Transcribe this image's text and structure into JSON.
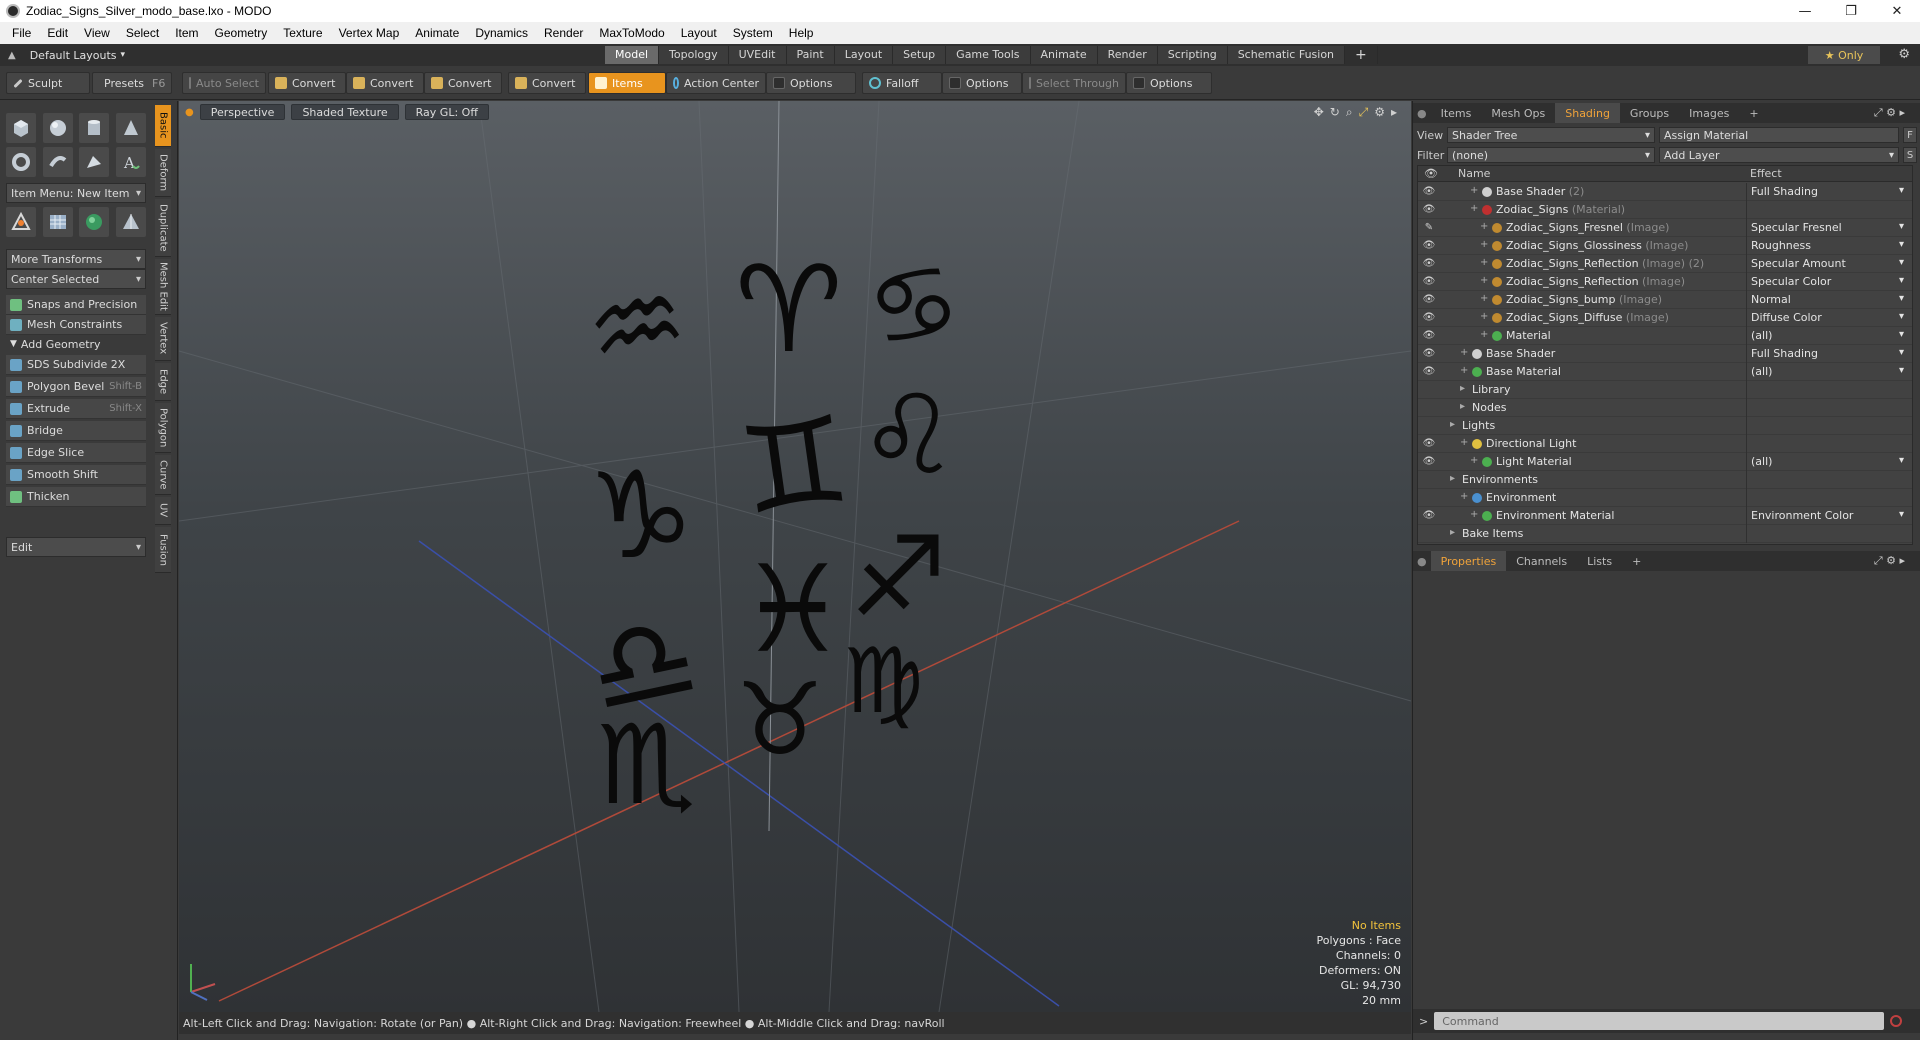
{
  "window": {
    "title": "Zodiac_Signs_Silver_modo_base.lxo - MODO",
    "controls": [
      "—",
      "❐",
      "✕"
    ]
  },
  "menu": [
    "File",
    "Edit",
    "View",
    "Select",
    "Item",
    "Geometry",
    "Texture",
    "Vertex Map",
    "Animate",
    "Dynamics",
    "Render",
    "MaxToModo",
    "Layout",
    "System",
    "Help"
  ],
  "layoutbar": {
    "layout_label": "Default Layouts",
    "tabs": [
      "Model",
      "Topology",
      "UVEdit",
      "Paint",
      "Layout",
      "Setup",
      "Game Tools",
      "Animate",
      "Render",
      "Scripting",
      "Schematic Fusion"
    ],
    "active_tab": "Model",
    "plus": "+",
    "only_label": "★  Only"
  },
  "toolbar": {
    "sculpt": "Sculpt",
    "presets": "Presets",
    "presets_key": "F6",
    "auto_select": "Auto Select",
    "convert": "Convert",
    "items": "Items",
    "action_center": "Action Center",
    "options": "Options",
    "falloff": "Falloff",
    "select_through": "Select Through"
  },
  "leftpanel": {
    "item_menu": "Item Menu: New Item",
    "more_transforms": "More Transforms",
    "center_selected": "Center Selected",
    "snaps": "Snaps and Precision",
    "mesh_constraints": "Mesh Constraints",
    "add_geometry": "Add Geometry",
    "tools": [
      {
        "label": "SDS Subdivide 2X",
        "key": ""
      },
      {
        "label": "Polygon Bevel",
        "key": "Shift-B"
      },
      {
        "label": "Extrude",
        "key": "Shift-X"
      },
      {
        "label": "Bridge",
        "key": ""
      },
      {
        "label": "Edge Slice",
        "key": ""
      },
      {
        "label": "Smooth Shift",
        "key": ""
      },
      {
        "label": "Thicken",
        "key": ""
      }
    ],
    "edit_dropdown": "Edit",
    "vtabs": [
      "Basic",
      "Deform",
      "Duplicate",
      "Mesh Edit",
      "Vertex",
      "Edge",
      "Polygon",
      "Curve",
      "UV",
      "Fusion"
    ]
  },
  "viewport": {
    "view_mode": "Perspective",
    "shading": "Shaded Texture",
    "raygl": "Ray GL: Off",
    "info": {
      "selection": "No Items",
      "polygons": "Polygons : Face",
      "channels": "Channels: 0",
      "deformers": "Deformers: ON",
      "gl": "GL: 94,730",
      "scale": "20 mm"
    },
    "glyphs": [
      "♒",
      "♈",
      "♋",
      "♑",
      "♊",
      "♌",
      "♓",
      "♐",
      "♎",
      "♉",
      "♏",
      "♍"
    ]
  },
  "statusbar": "Alt-Left Click and Drag: Navigation: Rotate (or Pan) ● Alt-Right Click and Drag: Navigation: Freewheel ● Alt-Middle Click and Drag: navRoll",
  "rightpanel": {
    "tabs": [
      "Items",
      "Mesh Ops",
      "Shading",
      "Groups",
      "Images"
    ],
    "active_tab": "Shading",
    "view_label": "View",
    "view_value": "Shader Tree",
    "assign_material": "Assign Material",
    "filter_label": "Filter",
    "filter_value": "(none)",
    "add_layer": "Add Layer",
    "col_name": "Name",
    "col_effect": "Effect",
    "tree": [
      {
        "name": "Base Shader",
        "sub": " (2)",
        "effect": "Full Shading",
        "color": "#d0d0d0",
        "indent": 3,
        "eye": true
      },
      {
        "name": "Zodiac_Signs",
        "sub": " (Material)",
        "effect": "",
        "color": "#c03030",
        "indent": 3,
        "eye": true
      },
      {
        "name": "Zodiac_Signs_Fresnel",
        "sub": " (Image)",
        "effect": "Specular Fresnel",
        "color": "#c08a30",
        "indent": 4,
        "eye": "brush"
      },
      {
        "name": "Zodiac_Signs_Glossiness",
        "sub": " (Image)",
        "effect": "Roughness",
        "color": "#c08a30",
        "indent": 4,
        "eye": true
      },
      {
        "name": "Zodiac_Signs_Reflection",
        "sub": " (Image) (2)",
        "effect": "Specular Amount",
        "color": "#c08a30",
        "indent": 4,
        "eye": true
      },
      {
        "name": "Zodiac_Signs_Reflection",
        "sub": " (Image)",
        "effect": "Specular Color",
        "color": "#c08a30",
        "indent": 4,
        "eye": true
      },
      {
        "name": "Zodiac_Signs_bump",
        "sub": " (Image)",
        "effect": "Normal",
        "color": "#c08a30",
        "indent": 4,
        "eye": true
      },
      {
        "name": "Zodiac_Signs_Diffuse",
        "sub": " (Image)",
        "effect": "Diffuse Color",
        "color": "#c08a30",
        "indent": 4,
        "eye": true
      },
      {
        "name": "Material",
        "sub": "",
        "effect": "(all)",
        "color": "#4caf50",
        "indent": 4,
        "eye": true
      },
      {
        "name": "Base Shader",
        "sub": "",
        "effect": "Full Shading",
        "color": "#d0d0d0",
        "indent": 2,
        "eye": true
      },
      {
        "name": "Base Material",
        "sub": "",
        "effect": "(all)",
        "color": "#4caf50",
        "indent": 2,
        "eye": true
      },
      {
        "name": "Library",
        "sub": "",
        "effect": "",
        "color": "",
        "indent": 2,
        "eye": false
      },
      {
        "name": "Nodes",
        "sub": "",
        "effect": "",
        "color": "",
        "indent": 2,
        "eye": false
      },
      {
        "name": "Lights",
        "sub": "",
        "effect": "",
        "color": "",
        "indent": 1,
        "eye": false
      },
      {
        "name": "Directional Light",
        "sub": "",
        "effect": "",
        "color": "#e0c040",
        "indent": 2,
        "eye": true
      },
      {
        "name": "Light Material",
        "sub": "",
        "effect": "(all)",
        "color": "#4caf50",
        "indent": 3,
        "eye": true
      },
      {
        "name": "Environments",
        "sub": "",
        "effect": "",
        "color": "",
        "indent": 1,
        "eye": false
      },
      {
        "name": "Environment",
        "sub": "",
        "effect": "",
        "color": "#4a90d0",
        "indent": 2,
        "eye": false
      },
      {
        "name": "Environment Material",
        "sub": "",
        "effect": "Environment Color",
        "color": "#4caf50",
        "indent": 3,
        "eye": true
      },
      {
        "name": "Bake Items",
        "sub": "",
        "effect": "",
        "color": "",
        "indent": 1,
        "eye": false
      }
    ],
    "props_tabs": [
      "Properties",
      "Channels",
      "Lists"
    ],
    "props_active": "Properties",
    "command_placeholder": "Command"
  }
}
